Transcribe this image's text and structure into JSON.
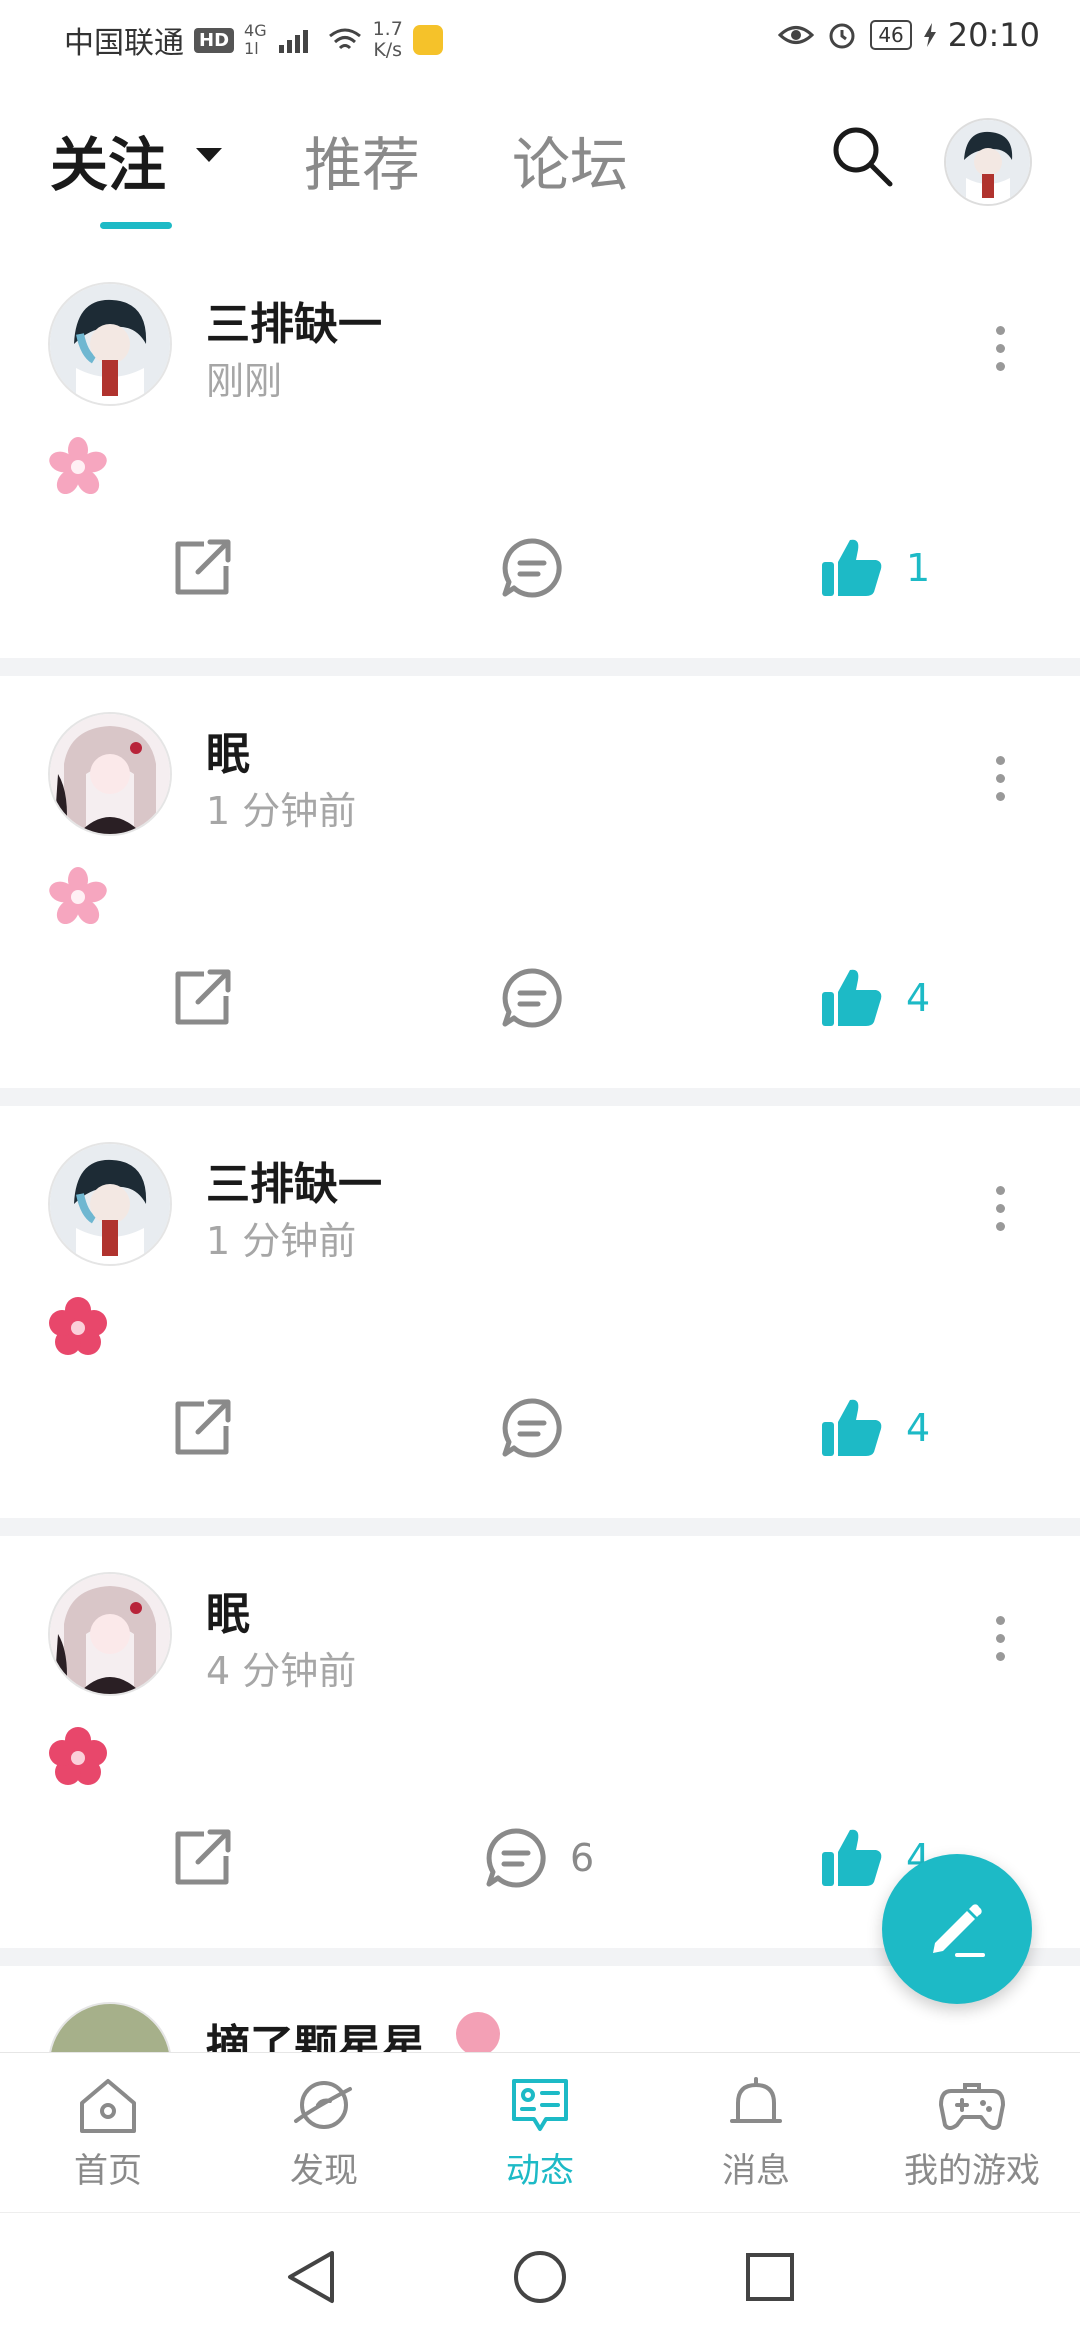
{
  "status_bar": {
    "carrier": "中国联通",
    "hd": "HD",
    "net_top": "4G",
    "net_bottom": "1l",
    "speed_top": "1.7",
    "speed_bottom": "K/s",
    "battery": "46",
    "time": "20:10"
  },
  "header": {
    "tabs": [
      {
        "label": "关注"
      },
      {
        "label": "推荐"
      },
      {
        "label": "论坛"
      }
    ]
  },
  "feed": {
    "posts": [
      {
        "name": "三排缺一",
        "time": "刚刚",
        "likes": "1"
      },
      {
        "name": "眠",
        "time": "1 分钟前",
        "likes": "4"
      },
      {
        "name": "三排缺一",
        "time": "1 分钟前",
        "likes": "4"
      },
      {
        "name": "眠",
        "time": "4 分钟前",
        "likes": "4",
        "comments": "6"
      }
    ],
    "partial_name": "摘了颗星星"
  },
  "bottom_nav": {
    "items": [
      {
        "label": "首页"
      },
      {
        "label": "发现"
      },
      {
        "label": "动态"
      },
      {
        "label": "消息"
      },
      {
        "label": "我的游戏"
      }
    ]
  },
  "colors": {
    "accent": "#1dbac6",
    "text_primary": "#1a1a1a",
    "text_secondary": "#a6a6a6"
  },
  "icons": [
    "search-icon",
    "caret-down-icon",
    "more-vert-icon",
    "share-icon",
    "comment-icon",
    "thumbs-up-icon",
    "edit-pen-icon",
    "home-icon",
    "discover-icon",
    "feed-icon",
    "bell-icon",
    "gamepad-icon",
    "back-triangle-icon",
    "home-circle-icon",
    "recents-square-icon"
  ]
}
